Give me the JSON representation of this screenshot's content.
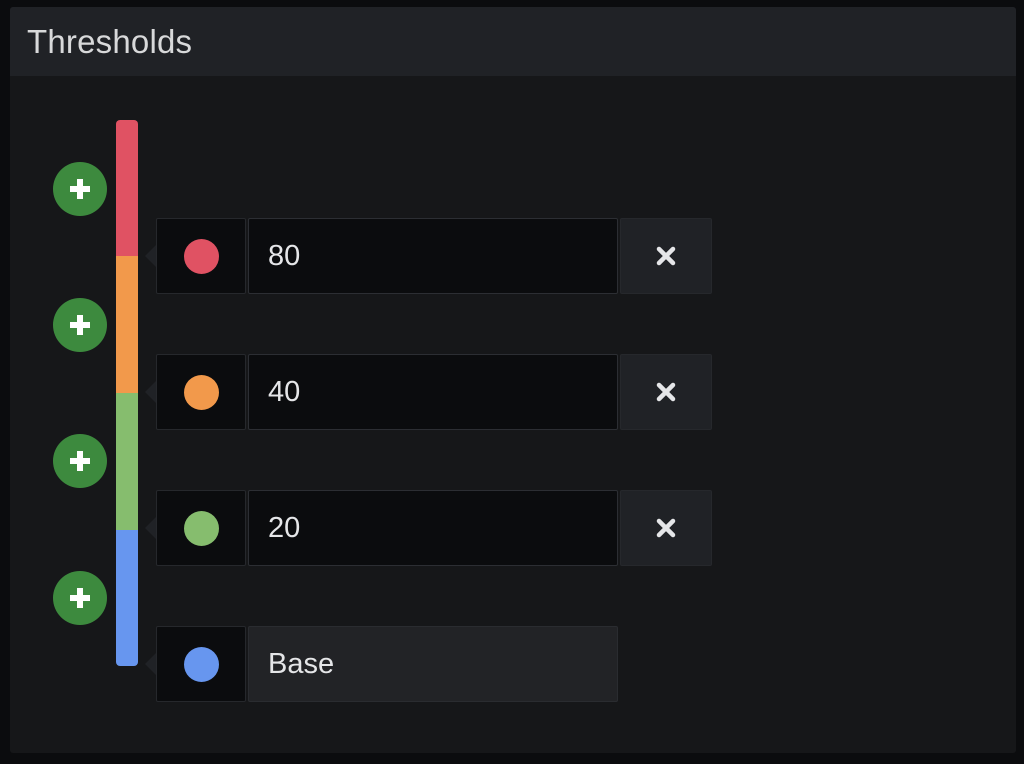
{
  "panel": {
    "title": "Thresholds"
  },
  "colors": {
    "red": "#e05263",
    "orange": "#f2994b",
    "green": "#86bd6e",
    "blue": "#6796ef",
    "add_button": "#3d8a3e"
  },
  "thresholds": [
    {
      "value": "80",
      "color": "#e05263",
      "removable": true
    },
    {
      "value": "40",
      "color": "#f2994b",
      "removable": true
    },
    {
      "value": "20",
      "color": "#86bd6e",
      "removable": true
    },
    {
      "value": "Base",
      "color": "#6796ef",
      "removable": false
    }
  ],
  "icons": {
    "add": "plus-circle-icon",
    "remove": "close-icon"
  }
}
